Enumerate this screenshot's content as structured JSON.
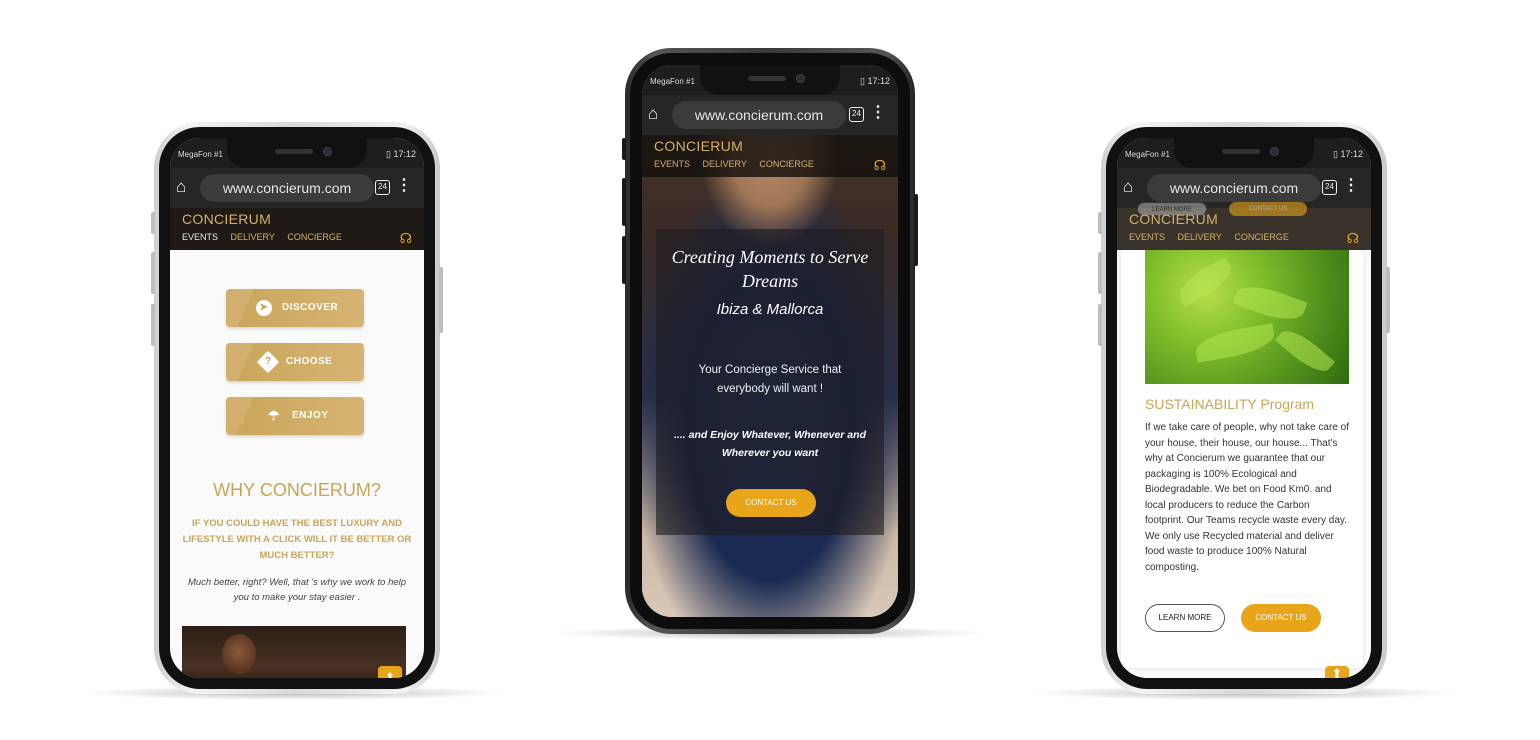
{
  "browser": {
    "url": "www.concierum.com",
    "tab_count": "24"
  },
  "status": {
    "carrier": "MegaFon #1",
    "time": "17:12",
    "battery": "80"
  },
  "site": {
    "logo": "CONCIERUM",
    "nav": [
      "EVENTS",
      "DELIVERY",
      "CONCIERGE"
    ]
  },
  "left": {
    "buttons": [
      {
        "label": "DISCOVER",
        "icon": "compass-icon"
      },
      {
        "label": "CHOOSE",
        "icon": "question-diamond-icon"
      },
      {
        "label": "ENJOY",
        "icon": "umbrella-icon"
      }
    ],
    "why_title": "WHY CONCIERUM?",
    "why_subtitle": "IF YOU COULD HAVE THE BEST LUXURY AND LIFESTYLE WITH A CLICK WILL IT BE BETTER OR MUCH BETTER?",
    "why_body": "Much better, right? Well, that 's why we work to help you to make your stay easier ."
  },
  "center": {
    "hero_title": "Creating Moments to Serve Dreams",
    "hero_location": "Ibiza & Mallorca",
    "hero_text": "Your Concierge Service that everybody will want !",
    "hero_enjoy": ".... and Enjoy Whatever, Whenever and Wherever you want",
    "contact_label": "CONTACT US"
  },
  "right": {
    "ghost_learn": "LEARN MORE",
    "ghost_contact": "CONTACT US",
    "sustainability_title": "SUSTAINABILITY Program",
    "sustainability_body": "If we take care of people, why not take care of your house, their house, our house... That's why at Concierum we guarantee that our packaging is 100% Ecological and Biodegradable. We bet on Food Km0. and local producers to reduce the Carbon footprint. Our Teams recycle waste every day. We only use Recycled material and deliver food waste to produce 100% Natural composting.",
    "learn_label": "LEARN MORE",
    "contact_label": "CONTACT US"
  },
  "colors": {
    "gold": "#c9a559",
    "orange": "#e9a51a",
    "dark": "#262626"
  }
}
